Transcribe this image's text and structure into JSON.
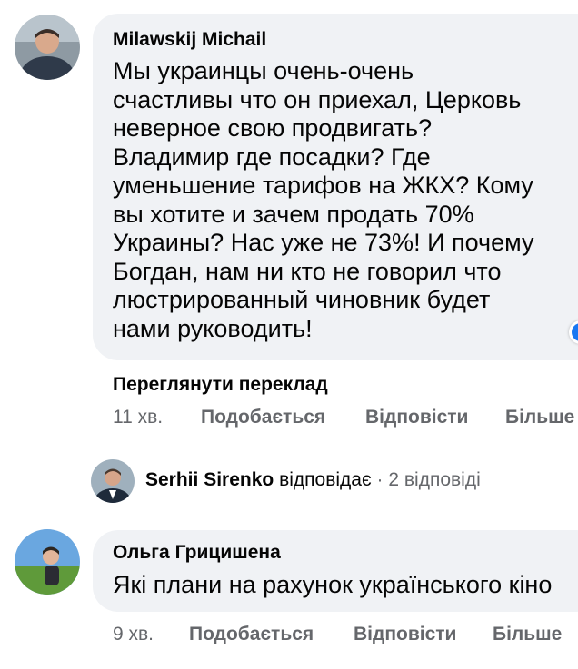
{
  "comments": [
    {
      "author": "Milawskij Michail",
      "text_lines": [
        "Мы украинцы очень-очень",
        "счастливы что он приехал, Церковь",
        "неверное свою продвигать?",
        "Владимир где посадки? Где",
        "уменьшение тарифов на ЖКХ? Кому",
        "вы хотите и зачем продать 70%",
        "Украины? Нас уже не 73%! И почему",
        "Богдан, нам ни кто не говорил что",
        "люстрированный чиновник будет",
        "нами руководить!"
      ],
      "see_translation": "Переглянути переклад",
      "time": "11 хв.",
      "like_label": "Подобається",
      "reply_label": "Відповісти",
      "more_label": "Більше",
      "reaction_icon": "like-reaction-icon"
    },
    {
      "author": "Ольга Грицишена",
      "text_lines": [
        "Які плани на рахунок українського кіно"
      ],
      "time": "9 хв.",
      "like_label": "Подобається",
      "reply_label": "Відповісти",
      "more_label": "Більше"
    }
  ],
  "reply_summary": {
    "name": "Serhii Sirenko",
    "verb": "відповідає",
    "separator": "·",
    "count": "2 відповіді"
  },
  "colors": {
    "bubble_bg": "#f0f2f5",
    "text": "#050505",
    "secondary_text": "#65676b",
    "accent_blue": "#1877f2"
  }
}
